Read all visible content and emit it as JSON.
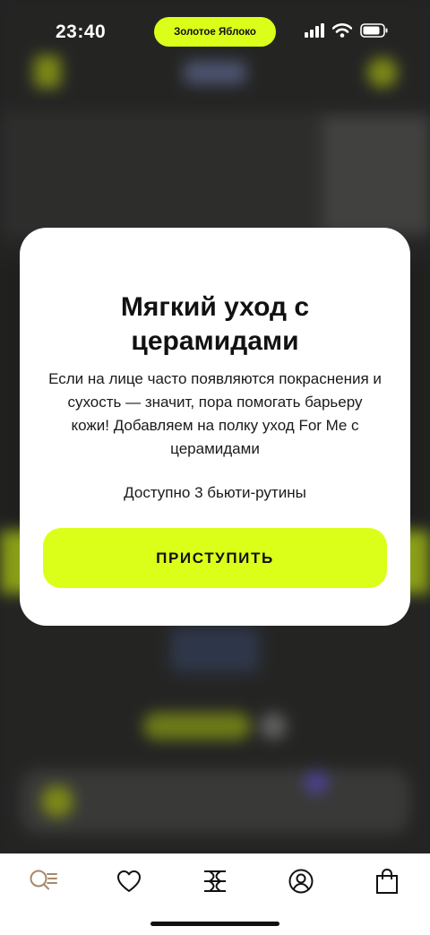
{
  "status_bar": {
    "time": "23:40",
    "pill_label": "Золотое Яблоко"
  },
  "modal": {
    "title": "Мягкий уход с церамидами",
    "text": "Если на лице часто появляются покраснения и сухость — значит, пора помогать барьеру кожи! Добавляем на полку уход For Me с церамидами",
    "availability": "Доступно 3 бьюти-рутины",
    "button_label": "ПРИСТУПИТЬ"
  },
  "tab_bar": {
    "items": [
      {
        "icon": "search-menu-icon",
        "active": true
      },
      {
        "icon": "heart-icon",
        "active": false
      },
      {
        "icon": "brand-logo-icon",
        "active": false
      },
      {
        "icon": "profile-icon",
        "active": false
      },
      {
        "icon": "shopping-bag-icon",
        "active": false
      }
    ]
  },
  "colors": {
    "accent": "#dcff1a",
    "active_tab": "#a8876a",
    "icon": "#111111"
  }
}
